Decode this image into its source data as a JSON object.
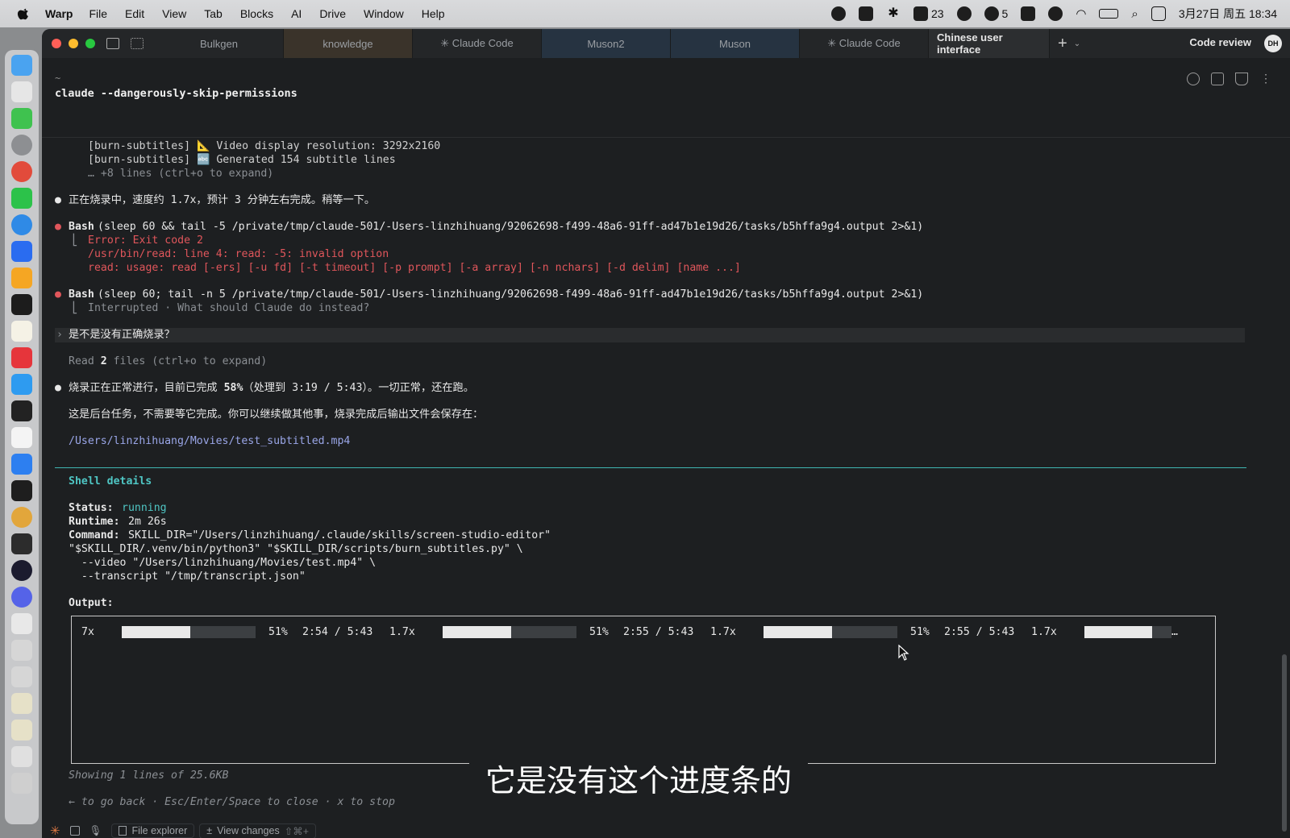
{
  "menubar": {
    "app": "Warp",
    "items": [
      "File",
      "Edit",
      "View",
      "Tab",
      "Blocks",
      "AI",
      "Drive",
      "Window",
      "Help"
    ],
    "badge_count_1": "23",
    "badge_count_2": "5",
    "datetime": "3月27日 周五  18:34"
  },
  "tabs": [
    {
      "label": "Bulkgen"
    },
    {
      "label": "knowledge"
    },
    {
      "label": "✳ Claude Code"
    },
    {
      "label": "Muson2"
    },
    {
      "label": "Muson"
    },
    {
      "label": "✳ Claude Code"
    },
    {
      "label": "Chinese user interface"
    }
  ],
  "header": {
    "code_review": "Code review",
    "avatar": "DH"
  },
  "terminal": {
    "tilde": "~",
    "command": "claude --dangerously-skip-permissions",
    "lines": {
      "l0": "[burn-subtitles] 📐 Video display resolution: 3292x2160",
      "l1": "[burn-subtitles] 🔤 Generated 154 subtitle lines",
      "l2": "… +8 lines (ctrl+o to expand)",
      "msg1": "正在烧录中，速度约 1.7x，预计 3 分钟左右完成。稍等一下。",
      "bash1_name": "Bash",
      "bash1_args": "(sleep 60 && tail -5 /private/tmp/claude-501/-Users-linzhihuang/92062698-f499-48a6-91ff-ad47b1e19d26/tasks/b5hffa9g4.output 2>&1)",
      "err1": "Error: Exit code 2",
      "err2": "/usr/bin/read: line 4: read: -5: invalid option",
      "err3": "read: usage: read [-ers] [-u fd] [-t timeout] [-p prompt] [-a array] [-n nchars] [-d delim] [name ...]",
      "bash2_name": "Bash",
      "bash2_args": "(sleep 60; tail -n 5 /private/tmp/claude-501/-Users-linzhihuang/92062698-f499-48a6-91ff-ad47b1e19d26/tasks/b5hffa9g4.output 2>&1)",
      "interrupted": "Interrupted · What should Claude do instead?",
      "user_prompt": "是不是没有正确烧录？",
      "read_files_pre": "Read ",
      "read_files_num": "2",
      "read_files_post": " files (ctrl+o to expand)",
      "msg2_pre": "烧录正在正常进行，目前已完成 ",
      "msg2_pct": "58%",
      "msg2_post": "（处理到 3:19 / 5:43）。一切正常，还在跑。",
      "msg3": "这是后台任务，不需要等它完成。你可以继续做其他事，烧录完成后输出文件会保存在：",
      "path": "/Users/linzhihuang/Movies/test_subtitled.mp4"
    },
    "shell": {
      "title": "Shell details",
      "status_label": "Status:",
      "status_value": "running",
      "runtime_label": "Runtime:",
      "runtime_value": "2m 26s",
      "command_label": "Command:",
      "command_l1": "SKILL_DIR=\"/Users/linzhihuang/.claude/skills/screen-studio-editor\"",
      "command_l2": "\"$SKILL_DIR/.venv/bin/python3\" \"$SKILL_DIR/scripts/burn_subtitles.py\" \\",
      "command_l3": "  --video \"/Users/linzhihuang/Movies/test.mp4\" \\",
      "command_l4": "  --transcript \"/tmp/transcript.json\"",
      "output_label": "Output:",
      "output_prefix": "7x",
      "progress": [
        {
          "pct": "51%",
          "time": "2:54 / 5:43",
          "speed": "1.7x",
          "fill": 0.51
        },
        {
          "pct": "51%",
          "time": "2:55 / 5:43",
          "speed": "1.7x",
          "fill": 0.51
        },
        {
          "pct": "51%",
          "time": "2:55 / 5:43",
          "speed": "1.7x",
          "fill": 0.51
        }
      ],
      "output_tail": "…",
      "showing": "Showing 1 lines of 25.6KB",
      "hint": "← to go back · Esc/Enter/Space to close · x to stop"
    },
    "subtitle_overlay": "它是没有这个进度条的"
  },
  "bottombar": {
    "file_explorer": "File explorer",
    "view_changes": "View changes",
    "view_changes_shortcut": "⇧⌘+"
  }
}
